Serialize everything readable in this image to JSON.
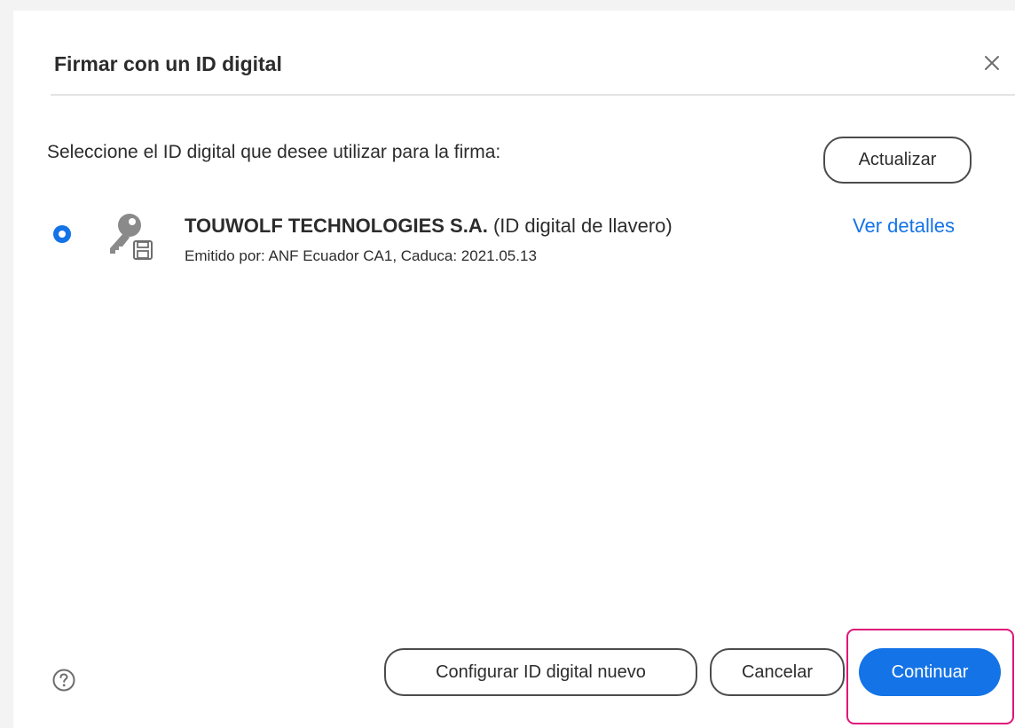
{
  "dialog": {
    "title": "Firmar con un ID digital",
    "close_icon": "close-icon",
    "instruction": "Seleccione el ID digital que desee utilizar para la firma:",
    "refresh_label": "Actualizar"
  },
  "digital_id": {
    "selected": true,
    "icon": "key-icon",
    "name": "TOUWOLF TECHNOLOGIES S.A.",
    "type_suffix": "(ID digital de llavero)",
    "issuer_line": "Emitido por: ANF Ecuador CA1, Caduca: 2021.05.13",
    "details_link": "Ver detalles"
  },
  "footer": {
    "help_icon": "help-icon",
    "setup_label": "Configurar ID digital nuevo",
    "cancel_label": "Cancelar",
    "continue_label": "Continuar"
  },
  "colors": {
    "accent": "#1473e6",
    "highlight": "#e0157a",
    "text": "#2c2c2c",
    "page_background": "#f3f3f3"
  }
}
